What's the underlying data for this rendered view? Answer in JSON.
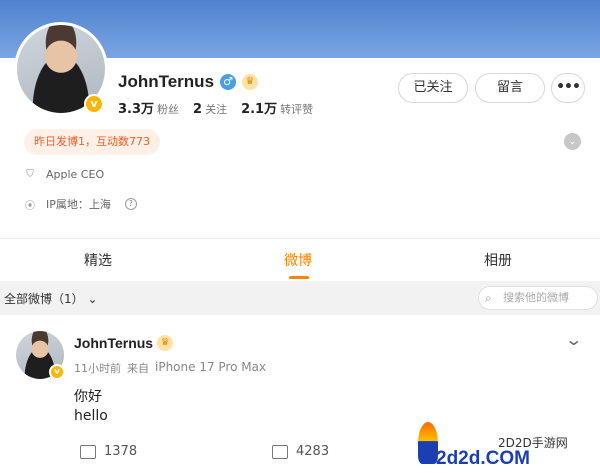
{
  "profile": {
    "name": "JohnTernus",
    "gender_icon": "♂",
    "verified_mark": "v",
    "stats": [
      {
        "value": "3.3万",
        "label": "粉丝"
      },
      {
        "value": "2",
        "label": "关注"
      },
      {
        "value": "2.1万",
        "label": "转评赞"
      }
    ],
    "buttons": {
      "follow": "已关注",
      "message": "留言",
      "more": "•••"
    },
    "activity": "昨日发博1，互动数773",
    "title": "Apple CEO",
    "ip_location": "IP属地：上海"
  },
  "tabs": [
    {
      "label": "精选",
      "active": false
    },
    {
      "label": "微博",
      "active": true
    },
    {
      "label": "相册",
      "active": false
    }
  ],
  "filter": {
    "label": "全部微博（1）",
    "search_placeholder": "搜索他的微博"
  },
  "post": {
    "author": "JohnTernus",
    "time": "11小时前",
    "source_prefix": "来自",
    "device": "iPhone 17 Pro Max",
    "lines": [
      "你好",
      "hello"
    ],
    "reposts": "1378",
    "comments": "4283"
  },
  "watermark": {
    "site": "2D2D手游网",
    "domain": "2d2d.COM"
  },
  "colors": {
    "accent": "#ff8200",
    "cover": "#5a8bd6",
    "badge": "#ffb400",
    "activity_text": "#ff5a1f"
  }
}
